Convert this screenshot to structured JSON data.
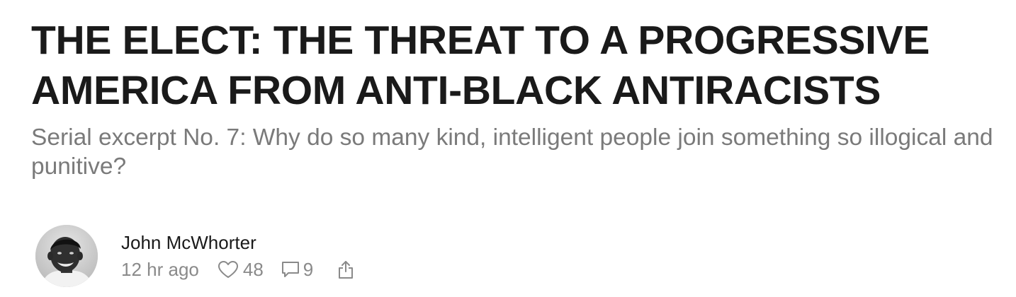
{
  "post": {
    "title": "THE ELECT: THE THREAT TO A PROGRESSIVE AMERICA FROM ANTI-BLACK ANTIRACISTS",
    "subtitle": "Serial excerpt No. 7: Why do so many kind, intelligent people join something so illogical and punitive?"
  },
  "byline": {
    "author": "John McWhorter",
    "time": "12 hr ago",
    "likes": "48",
    "comments": "9"
  },
  "icons": {
    "like": "heart-icon",
    "comment": "comment-bubble-icon",
    "share": "share-icon"
  },
  "colors": {
    "title": "#1a1a1a",
    "subtitle": "#7a7a7a",
    "meta": "#8a8a8a"
  }
}
